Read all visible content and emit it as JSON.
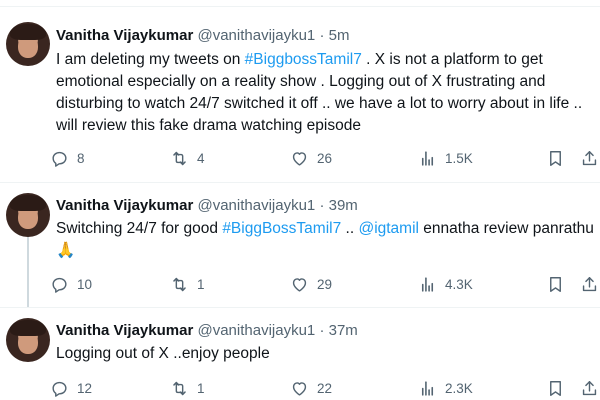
{
  "tweets": [
    {
      "name": "Vanitha Vijaykumar",
      "handle": "@vanithavijayku1",
      "dot": "·",
      "time": "5m",
      "text_parts": {
        "a": "I am deleting my tweets on ",
        "b": "#BiggbossTamil7",
        "c": " . X is not a platform to get emotional especially on a reality show . Logging out of X  frustrating and disturbing to watch 24/7 switched it off .. we have a lot to worry about in life .. will review this fake drama watching  episode"
      },
      "replies": "8",
      "retweets": "4",
      "likes": "26",
      "views": "1.5K"
    },
    {
      "name": "Vanitha Vijaykumar",
      "handle": "@vanithavijayku1",
      "dot": "·",
      "time": "39m",
      "text_parts": {
        "a": "Switching 24/7 for good ",
        "b": "#BiggBossTamil7",
        "c": " .. ",
        "d": "@igtamil",
        "e": " ennatha review panrathu 🙏"
      },
      "replies": "10",
      "retweets": "1",
      "likes": "29",
      "views": "4.3K"
    },
    {
      "name": "Vanitha Vijaykumar",
      "handle": "@vanithavijayku1",
      "dot": "·",
      "time": "37m",
      "text_parts": {
        "a": "Logging out of X ..enjoy people"
      },
      "replies": "12",
      "retweets": "1",
      "likes": "22",
      "views": "2.3K"
    }
  ],
  "icons": {
    "reply": "reply-icon",
    "retweet": "retweet-icon",
    "like": "heart-icon",
    "views": "views-icon",
    "bookmark": "bookmark-icon",
    "share": "share-icon"
  },
  "colors": {
    "text": "#0f1419",
    "muted": "#536471",
    "link": "#1d9bf0",
    "divider": "#eff3f4"
  }
}
